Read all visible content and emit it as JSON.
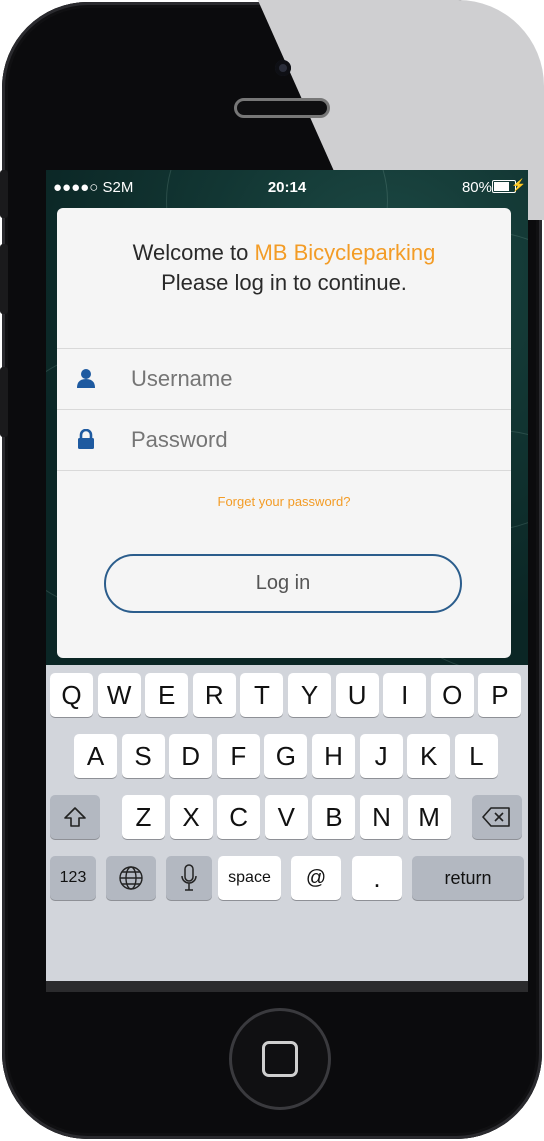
{
  "status_bar": {
    "carrier": "●●●●○ S2M",
    "time": "20:14",
    "battery": "80%",
    "battery_level": 0.8
  },
  "login": {
    "welcome_prefix": "Welcome to ",
    "brand_name": "MB Bicycleparking",
    "subtitle": "Please log in to continue.",
    "username_placeholder": "Username",
    "password_placeholder": "Password",
    "forgot_link": "Forget your password?",
    "login_button": "Log in"
  },
  "keyboard": {
    "row1": [
      "Q",
      "W",
      "E",
      "R",
      "T",
      "Y",
      "U",
      "I",
      "O",
      "P"
    ],
    "row2": [
      "A",
      "S",
      "D",
      "F",
      "G",
      "H",
      "J",
      "K",
      "L"
    ],
    "row3": [
      "Z",
      "X",
      "C",
      "V",
      "B",
      "N",
      "M"
    ],
    "numbers_key": "123",
    "space_key": "space",
    "at_key": "@",
    "period_key": ".",
    "return_key": "return"
  },
  "icons": [
    "user-icon",
    "lock-icon",
    "shift-icon",
    "backspace-icon",
    "globe-icon",
    "microphone-icon",
    "home-button-icon",
    "camera-icon",
    "speaker-icon",
    "battery-icon",
    "charging-icon"
  ],
  "colors": {
    "accent_orange": "#f39c26",
    "icon_blue": "#1e5aa0",
    "button_border": "#2b5d8c",
    "wallpaper": "#123633"
  }
}
